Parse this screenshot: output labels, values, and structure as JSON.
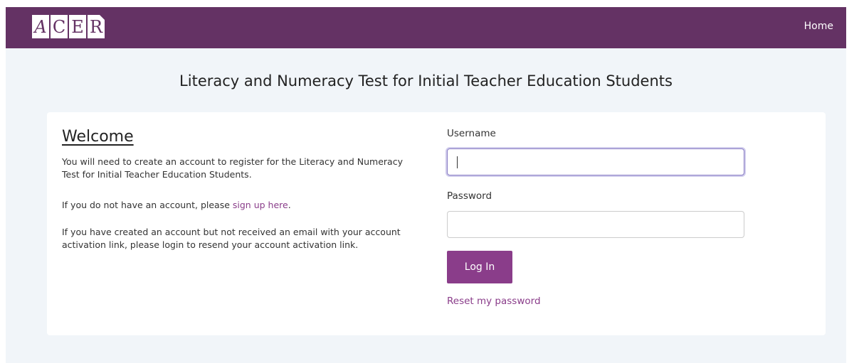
{
  "header": {
    "logo_letters": [
      "A",
      "C",
      "E",
      "R"
    ],
    "nav_home": "Home"
  },
  "page": {
    "title": "Literacy and Numeracy Test for Initial Teacher Education Students"
  },
  "welcome": {
    "heading": "Welcome",
    "para1": "You will need to create an account to register for the Literacy and Numeracy Test for Initial Teacher Education Students.",
    "para2_prefix": "If you do not have an account, please ",
    "para2_link": "sign up here",
    "para2_suffix": ".",
    "para3": "If you have created an account but not received an email with your account activation link, please login to resend your account activation link."
  },
  "login": {
    "username_label": "Username",
    "username_value": "",
    "password_label": "Password",
    "password_value": "",
    "submit_label": "Log In",
    "reset_link": "Reset my password"
  },
  "colors": {
    "brand": "#643264",
    "accent": "#8a3d8a",
    "background": "#f1f5f9"
  }
}
